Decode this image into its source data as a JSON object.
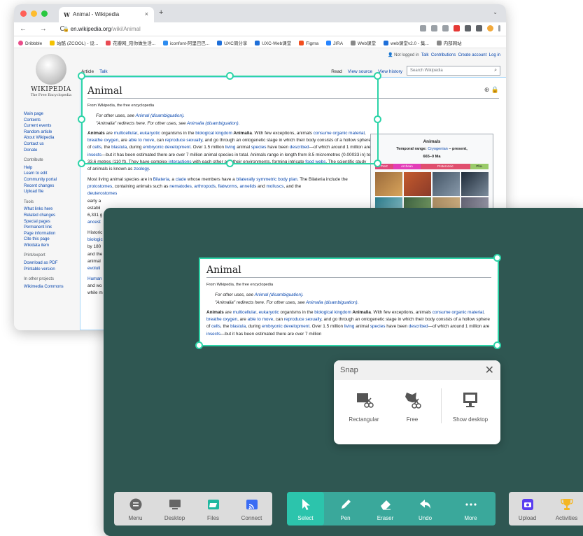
{
  "browser": {
    "tab_title": "Animal - Wikipedia",
    "tab_close": "×",
    "new_tab": "+",
    "url_host": "en.wikipedia.org",
    "url_path": "/wiki/Animal",
    "nav_glyphs": "← → C",
    "bookmarks": [
      "Dribbble",
      "站酷 (ZCOOL) - 设...",
      "花瓣网_陪你做生活...",
      "iconfont-阿里巴巴...",
      "UXC周分享",
      "UXC-Web课堂",
      "Figma",
      "JIRA",
      "Web课堂",
      "web课堂v2.0 - 集...",
      "内部网站"
    ]
  },
  "wiki": {
    "user_links": {
      "not_logged": "Not logged in",
      "talk": "Talk",
      "contributions": "Contributions",
      "create": "Create account",
      "login": "Log in"
    },
    "logo_title": "WIKIPEDIA",
    "logo_sub": "The Free Encyclopedia",
    "tabs_left": [
      "Article",
      "Talk"
    ],
    "tabs_right": [
      "Read",
      "View source",
      "View history"
    ],
    "search_placeholder": "Search Wikipedia",
    "nav": [
      "Main page",
      "Contents",
      "Current events",
      "Random article",
      "About Wikipedia",
      "Contact us",
      "Donate"
    ],
    "contribute_hd": "Contribute",
    "contribute": [
      "Help",
      "Learn to edit",
      "Community portal",
      "Recent changes",
      "Upload file"
    ],
    "tools_hd": "Tools",
    "tools": [
      "What links here",
      "Related changes",
      "Special pages",
      "Permanent link",
      "Page information",
      "Cite this page",
      "Wikidata item"
    ],
    "print_hd": "Print/export",
    "print": [
      "Download as PDF",
      "Printable version"
    ],
    "other_hd": "In other projects",
    "other": [
      "Wikimedia Commons"
    ],
    "title": "Animal",
    "from": "From Wikipedia, the free encyclopedia",
    "hat1a": "For other uses, see ",
    "hat1b": "Animal (disambiguation).",
    "hat2a": "\"Animalia\" redirects here. For other uses, see ",
    "hat2b": "Animalia (disambiguation).",
    "p1": {
      "a": "Animals",
      "b": " are ",
      "c": "multicellular",
      "d": ", ",
      "e": "eukaryotic",
      "f": " organisms in the ",
      "g": "biological kingdom",
      "h": " Animalia",
      "i": ". With few exceptions, animals ",
      "j": "consume organic material",
      "k": ", ",
      "l": "breathe oxygen",
      "m": ", are ",
      "n": "able to move",
      "o": ", can ",
      "p": "reproduce sexually",
      "q": ", and go through an ontogenetic stage in which their body consists of a hollow sphere of ",
      "r": "cells",
      "s": ", the ",
      "t": "blastula",
      "u": ", during ",
      "v": "embryonic development",
      "w": ". Over 1.5 million ",
      "x": "living",
      "y": " animal ",
      "z": "species",
      "aa": " have been ",
      "ab": "described",
      "ac": "—of which around 1 million are ",
      "ad": "insects",
      "ae": "—but it has been estimated there are over 7 million",
      "af": " animal species in total. Animals range in length from 8.5 micrometres (0.00033 in) to 33.6 metres (110 ft). They have complex ",
      "ag": "interactions",
      "ah": " with each other and their environments, forming intricate ",
      "ai": "food webs",
      "aj": ". The scientific study of animals is known as ",
      "ak": "zoology",
      "al": "."
    },
    "p2": {
      "a": "Most living animal species are in ",
      "b": "Bilateria",
      "c": ", a ",
      "d": "clade",
      "e": " whose members have a ",
      "f": "bilaterally symmetric body plan",
      "g": ". The Bilateria include the ",
      "h": "protostomes",
      "i": ", containing animals such as ",
      "j": "nematodes",
      "k": ", ",
      "l": "arthropods",
      "m": ", ",
      "n": "flatworms",
      "o": ", ",
      "p": "annelids",
      "q": " and ",
      "r": "molluscs",
      "s": ", and the"
    },
    "p2_lines": [
      "deuterostomes",
      "early a",
      "establi",
      "6,331 g",
      "ancest"
    ],
    "p3_lines": [
      "Historic",
      "biologic",
      "by 180",
      "and the",
      "animal",
      "evoluti"
    ],
    "p4_lines": [
      "Human",
      "and wo",
      "while m"
    ],
    "infobox": {
      "title": "Animals",
      "range_label": "Temporal range: ",
      "range_link": "Cryogenian",
      "range_rest": " – present,",
      "range_2": "665–0 Ma",
      "periods": [
        "PreЄ",
        "Archean",
        "Proterozoic",
        "Pha."
      ]
    }
  },
  "snap": {
    "title": "Snap",
    "close": "✕",
    "options": [
      {
        "label": "Rectangular",
        "icon": "rectangular-snip-icon"
      },
      {
        "label": "Free",
        "icon": "free-snip-icon"
      },
      {
        "label": "Show desktop",
        "icon": "monitor-icon"
      }
    ]
  },
  "dock": {
    "left": [
      {
        "label": "Menu",
        "icon": "menu-icon"
      },
      {
        "label": "Desktop",
        "icon": "desktop-icon"
      },
      {
        "label": "Files",
        "icon": "folder-icon"
      },
      {
        "label": "Connect",
        "icon": "connect-icon"
      }
    ],
    "tools": [
      {
        "label": "Select",
        "icon": "cursor-icon",
        "active": true
      },
      {
        "label": "Pen",
        "icon": "pen-icon"
      },
      {
        "label": "Eraser",
        "icon": "eraser-icon"
      },
      {
        "label": "Undo",
        "icon": "undo-icon"
      },
      {
        "label": "More",
        "icon": "more-icon"
      }
    ],
    "right": [
      {
        "label": "Upload",
        "icon": "camera-icon"
      },
      {
        "label": "Activities",
        "icon": "trophy-icon"
      }
    ]
  },
  "colors": {
    "accent": "#2dd4a8",
    "board": "#2f5752",
    "tool_green": "#3aa89b",
    "link": "#0645ad"
  }
}
